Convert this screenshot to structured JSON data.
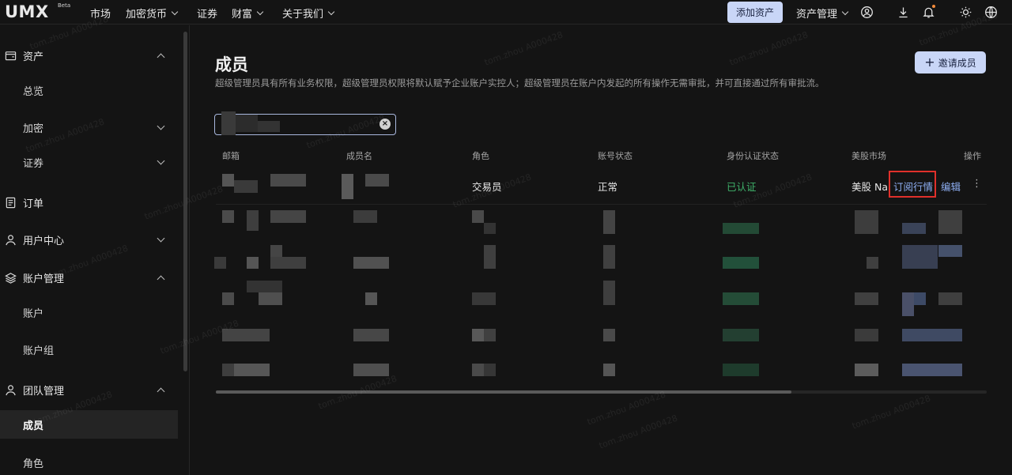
{
  "nav": {
    "logo": "UMX",
    "beta": "Beta",
    "items": [
      {
        "label": "市场",
        "dropdown": false
      },
      {
        "label": "加密货币",
        "dropdown": true
      },
      {
        "label": "证券",
        "dropdown": false
      },
      {
        "label": "财富",
        "dropdown": true
      },
      {
        "label": "关于我们",
        "dropdown": true
      }
    ],
    "add_asset": "添加资产",
    "asset_mgmt": "资产管理"
  },
  "sidebar": {
    "groups": [
      {
        "label": "资产",
        "icon": "wallet-icon",
        "expanded": true
      },
      {
        "label": "订单",
        "icon": "order-icon"
      },
      {
        "label": "用户中心",
        "icon": "user-icon",
        "expanded": false
      },
      {
        "label": "账户管理",
        "icon": "layers-icon",
        "expanded": true
      },
      {
        "label": "团队管理",
        "icon": "team-icon",
        "expanded": true
      }
    ],
    "items": [
      {
        "label": "总览"
      },
      {
        "label": "加密"
      },
      {
        "label": "证券"
      },
      {
        "label": "账户"
      },
      {
        "label": "账户组"
      },
      {
        "label": "成员",
        "active": true
      },
      {
        "label": "角色"
      }
    ]
  },
  "page": {
    "title": "成员",
    "description": "超级管理员具有所有业务权限，超级管理员权限将默认赋予企业账户实控人；超级管理员在账户内发起的所有操作无需审批，并可直接通过所有审批流。",
    "invite_button": "邀请成员",
    "search_clear": "×"
  },
  "table": {
    "columns": [
      "邮箱",
      "成员名",
      "角色",
      "账号状态",
      "身份认证状态",
      "美股市场",
      "操作"
    ],
    "first_row": {
      "role": "交易员",
      "status": "正常",
      "kyc": "已认证",
      "market": "美股 Na",
      "actions": {
        "subscribe": "订阅行情",
        "edit": "编辑",
        "more": "⋮"
      }
    }
  },
  "watermark": "tom.zhou A000428",
  "colors": {
    "accent": "#c9d6f7",
    "link": "#8fb0f5",
    "success": "#3fb36b",
    "highlight": "#e0302b",
    "bg": "#141414"
  }
}
